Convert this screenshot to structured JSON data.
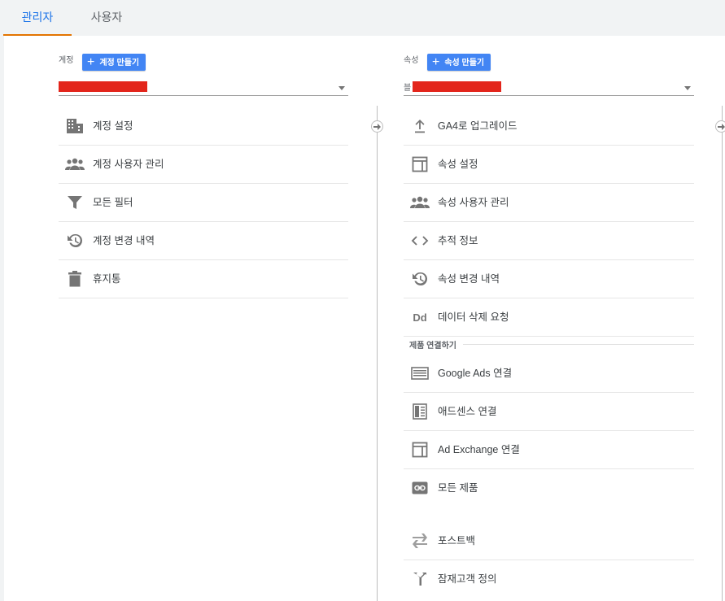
{
  "tabs": [
    {
      "label": "관리자",
      "active": true
    },
    {
      "label": "사용자",
      "active": false
    }
  ],
  "account": {
    "label": "계정",
    "create_button": "계정 만들기",
    "selector_value_redacted": true,
    "items": [
      {
        "icon": "building-icon",
        "label": "계정 설정"
      },
      {
        "icon": "people-icon",
        "label": "계정 사용자 관리"
      },
      {
        "icon": "filter-icon",
        "label": "모든 필터"
      },
      {
        "icon": "history-icon",
        "label": "계정 변경 내역"
      },
      {
        "icon": "trash-icon",
        "label": "휴지통"
      }
    ]
  },
  "property": {
    "label": "속성",
    "create_button": "속성 만들기",
    "selector_prefix": "블",
    "selector_value_redacted": true,
    "items": [
      {
        "icon": "upload-icon",
        "label": "GA4로 업그레이드"
      },
      {
        "icon": "layout-icon",
        "label": "속성 설정"
      },
      {
        "icon": "people-icon",
        "label": "속성 사용자 관리"
      },
      {
        "icon": "code-icon",
        "label": "추적 정보"
      },
      {
        "icon": "history-icon",
        "label": "속성 변경 내역"
      },
      {
        "icon": "data-deletion-icon",
        "label": "데이터 삭제 요청"
      }
    ],
    "section_title": "제품 연결하기",
    "product_items": [
      {
        "icon": "google-ads-icon",
        "label": "Google Ads 연결"
      },
      {
        "icon": "adsense-icon",
        "label": "애드센스 연결"
      },
      {
        "icon": "ad-exchange-icon",
        "label": "Ad Exchange 연결"
      },
      {
        "icon": "link-icon",
        "label": "모든 제품"
      }
    ],
    "extra_items": [
      {
        "icon": "postback-icon",
        "label": "포스트백"
      },
      {
        "icon": "audience-icon",
        "label": "잠재고객 정의"
      }
    ]
  },
  "colors": {
    "accent": "#1a73e8",
    "tab_indicator": "#e37400",
    "button": "#4285f4",
    "redaction": "#e3251b",
    "icon": "#757575"
  }
}
